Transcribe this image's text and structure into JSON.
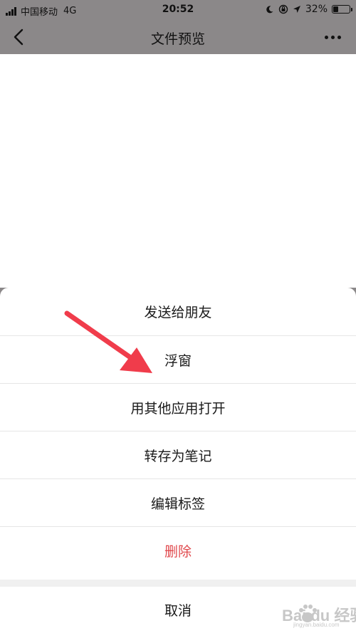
{
  "status_bar": {
    "carrier": "中国移动",
    "network": "4G",
    "time": "20:52",
    "battery_percent_text": "32%",
    "battery_level": 0.32
  },
  "nav": {
    "title": "文件预览",
    "back_icon": "chevron-left-icon",
    "more_icon": "more-dots-icon"
  },
  "action_sheet": {
    "items": [
      {
        "label": "发送给朋友"
      },
      {
        "label": "浮窗"
      },
      {
        "label": "用其他应用打开"
      },
      {
        "label": "转存为笔记"
      },
      {
        "label": "编辑标签"
      },
      {
        "label": "删除"
      }
    ],
    "cancel_label": "取消",
    "danger_color": "#e0484c"
  },
  "annotation": {
    "arrow_color": "#f03c4b"
  },
  "watermark": {
    "brand": "Bai du 经验",
    "sub": "jingyan.baidu.com"
  }
}
